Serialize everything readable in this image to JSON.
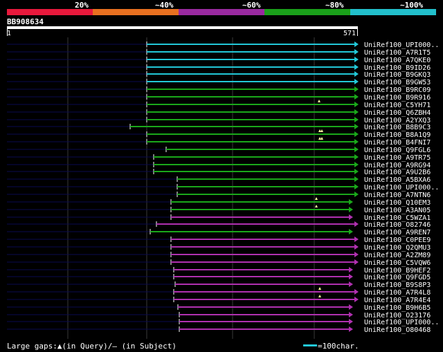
{
  "scale": {
    "labels": [
      "20%",
      "~40%",
      "~60%",
      "~80%",
      "~100%"
    ],
    "colors": [
      "#e8193c",
      "#e87020",
      "#9a2aa0",
      "#1aa01a",
      "#22c0cc"
    ]
  },
  "query": {
    "id": "BB908634",
    "start": "1",
    "end": "571"
  },
  "colors": {
    "cyan": "#22c8d8",
    "green": "#1aa81a",
    "magenta": "#b030b0",
    "gap_line": "#0a0a50",
    "grid": "#3a3a3a"
  },
  "hits": [
    {
      "name": "UniRef100_UPI000..",
      "color": "cyan"
    },
    {
      "name": "UniRef100_A7R1T5",
      "color": "cyan"
    },
    {
      "name": "UniRef100_A7QKE0",
      "color": "cyan"
    },
    {
      "name": "UniRef100_B9ID26",
      "color": "cyan"
    },
    {
      "name": "UniRef100_B9GKQ3",
      "color": "cyan"
    },
    {
      "name": "UniRef100_B9GW53",
      "color": "cyan"
    },
    {
      "name": "UniRef100_B9RC09",
      "color": "green"
    },
    {
      "name": "UniRef100_B9R916",
      "color": "green"
    },
    {
      "name": "UniRef100_C5YH71",
      "color": "green"
    },
    {
      "name": "UniRef100_Q6ZBH4",
      "color": "green"
    },
    {
      "name": "UniRef100_A2YXQ3",
      "color": "green"
    },
    {
      "name": "UniRef100_B8B9C3",
      "color": "green"
    },
    {
      "name": "UniRef100_B8A1Q9",
      "color": "green"
    },
    {
      "name": "UniRef100_B4FNI7",
      "color": "green"
    },
    {
      "name": "UniRef100_Q9FGL6",
      "color": "green"
    },
    {
      "name": "UniRef100_A9TR75",
      "color": "green"
    },
    {
      "name": "UniRef100_A9RG94",
      "color": "green"
    },
    {
      "name": "UniRef100_A9U2B6",
      "color": "green"
    },
    {
      "name": "UniRef100_A5BXA6",
      "color": "green"
    },
    {
      "name": "UniRef100_UPI000..",
      "color": "green"
    },
    {
      "name": "UniRef100_A7NTN6",
      "color": "green"
    },
    {
      "name": "UniRef100_Q10EM3",
      "color": "green"
    },
    {
      "name": "UniRef100_A3AN05",
      "color": "green"
    },
    {
      "name": "UniRef100_C5WZA1",
      "color": "magenta"
    },
    {
      "name": "UniRef100_O82746",
      "color": "magenta"
    },
    {
      "name": "UniRef100_A9REN7",
      "color": "green"
    },
    {
      "name": "UniRef100_C0PEE9",
      "color": "magenta"
    },
    {
      "name": "UniRef100_Q2QMU3",
      "color": "magenta"
    },
    {
      "name": "UniRef100_A2ZM89",
      "color": "magenta"
    },
    {
      "name": "UniRef100_C5VQW6",
      "color": "magenta"
    },
    {
      "name": "UniRef100_B9HEF2",
      "color": "magenta"
    },
    {
      "name": "UniRef100_Q9FGD5",
      "color": "magenta"
    },
    {
      "name": "UniRef100_B9S8P3",
      "color": "magenta"
    },
    {
      "name": "UniRef100_A7R4L8",
      "color": "magenta"
    },
    {
      "name": "UniRef100_A7R4E4",
      "color": "magenta"
    },
    {
      "name": "UniRef100_B9H6B5",
      "color": "magenta"
    },
    {
      "name": "UniRef100_O23176",
      "color": "magenta"
    },
    {
      "name": "UniRef100_UPI000..",
      "color": "magenta"
    },
    {
      "name": "UniRef100_O80468",
      "color": "magenta"
    }
  ],
  "footer": {
    "gaps_text": "Large gaps:▲(in Query)/– (in Subject)",
    "legend_text": "=100char."
  }
}
